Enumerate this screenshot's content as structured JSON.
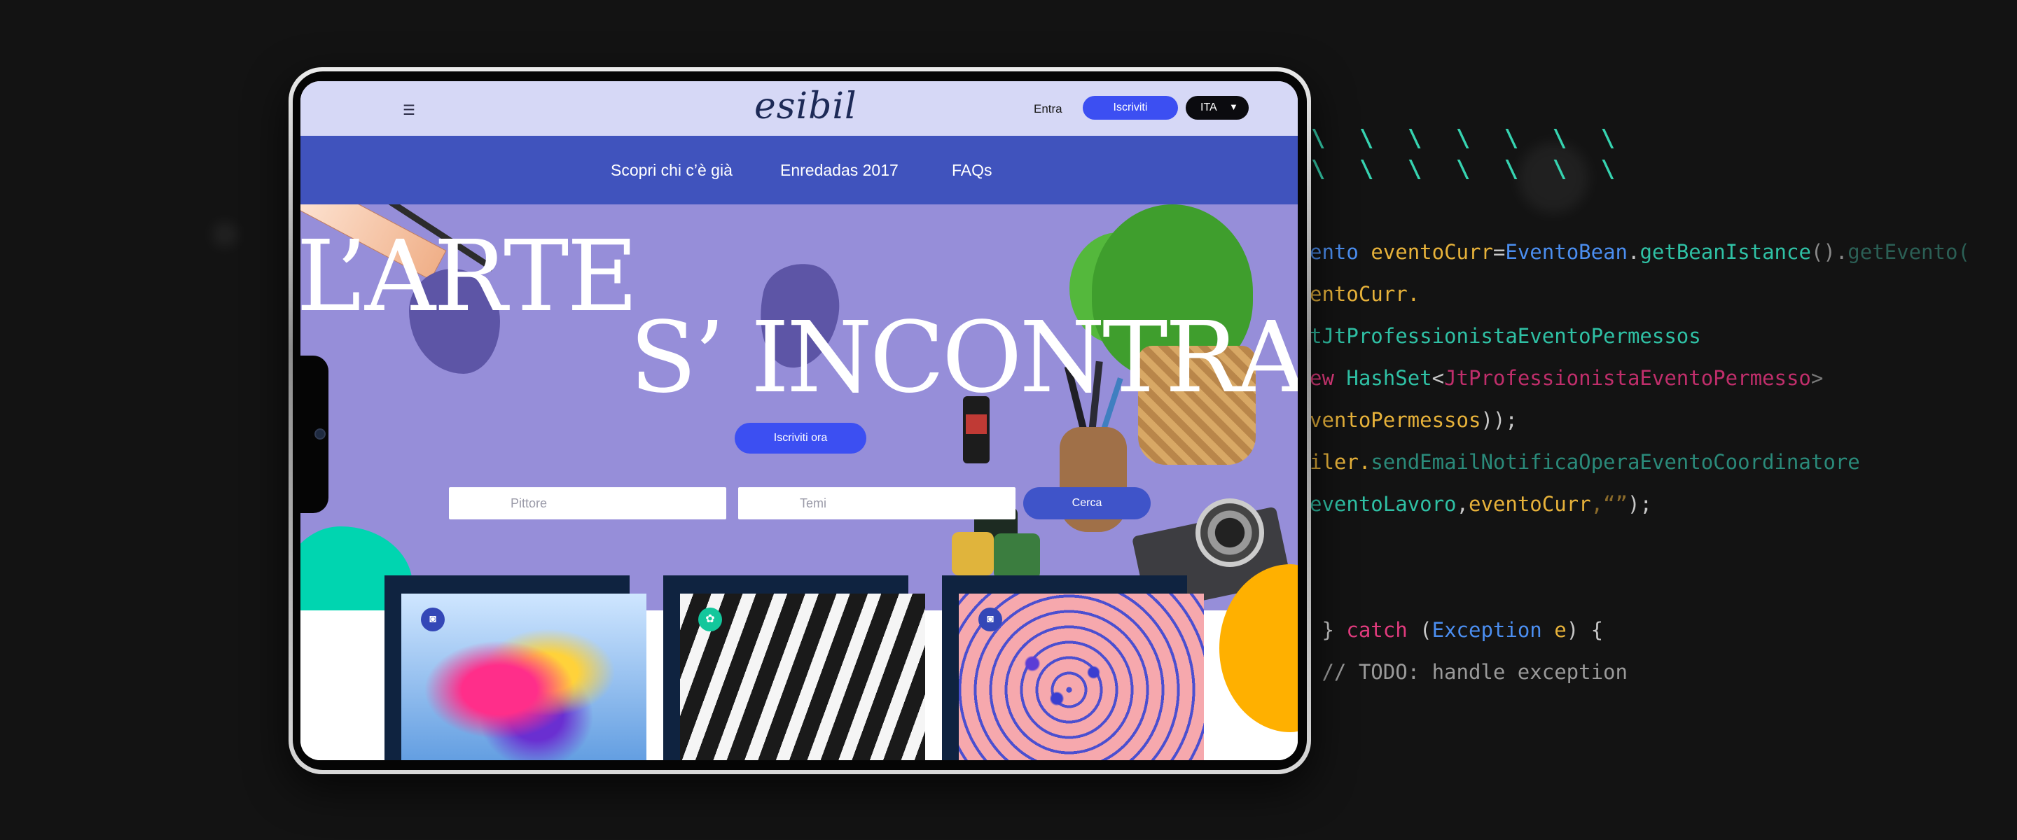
{
  "code_panel": {
    "slashes": [
      "\\ \\ \\ \\ \\ \\ \\",
      "\\ \\ \\ \\ \\ \\ \\"
    ],
    "lines": [
      [
        {
          "t": "ento ",
          "c": "#4b8ef0"
        },
        {
          "t": "eventoCurr",
          "c": "#e7b23a"
        },
        {
          "t": "=",
          "c": "#c7c7c7"
        },
        {
          "t": "EventoBean",
          "c": "#4b8ef0"
        },
        {
          "t": ".",
          "c": "#c7c7c7"
        },
        {
          "t": "getBeanIstance",
          "c": "#2fc1a5"
        },
        {
          "t": "().",
          "c": "#8a8a8a"
        },
        {
          "t": "getEvento(",
          "c": "#2b5f55"
        }
      ],
      [
        {
          "t": "entoCurr.",
          "c": "#e7b23a"
        }
      ],
      [
        {
          "t": "tJtProfessionistaEventoPermessos",
          "c": "#2fc1a5"
        }
      ],
      [
        {
          "t": "ew ",
          "c": "#e23b7e"
        },
        {
          "t": "HashSet",
          "c": "#2fc1a5"
        },
        {
          "t": "<",
          "c": "#c7c7c7"
        },
        {
          "t": "JtProfessionistaEventoPermesso",
          "c": "#c02e6b"
        },
        {
          "t": ">",
          "c": "#777777"
        }
      ],
      [
        {
          "t": "ventoPermessos",
          "c": "#e7b23a"
        },
        {
          "t": "));",
          "c": "#c7c7c7"
        }
      ],
      [
        {
          "t": "iler.",
          "c": "#e7b23a"
        },
        {
          "t": "sendEmailNotificaOperaEventoCoordinatore",
          "c": "#2a8a7a"
        }
      ],
      [
        {
          "t": "eventoLavoro",
          "c": "#2fc1a5"
        },
        {
          "t": ",",
          "c": "#c7c7c7"
        },
        {
          "t": "eventoCurr",
          "c": "#e7b23a"
        },
        {
          "t": ",“”",
          "c": "#8a6a2a"
        },
        {
          "t": ");",
          "c": "#c7c7c7"
        }
      ],
      [],
      [
        {
          "t": " } ",
          "c": "#c7c7c7"
        },
        {
          "t": "catch ",
          "c": "#e23b7e"
        },
        {
          "t": "(",
          "c": "#c7c7c7"
        },
        {
          "t": "Exception ",
          "c": "#4b8ef0"
        },
        {
          "t": "e",
          "c": "#e7b23a"
        },
        {
          "t": ") {",
          "c": "#c7c7c7"
        }
      ],
      [
        {
          "t": " // TODO: handle exception",
          "c": "#9a9a9a"
        }
      ]
    ]
  },
  "header": {
    "menu_icon": "☰",
    "logo": "esibil",
    "login": "Entra",
    "signup": "Iscriviti",
    "language": "ITA",
    "language_caret": "▼"
  },
  "nav": {
    "items": [
      "Scopri chi c’è già",
      "Enredadas 2017",
      "FAQs"
    ]
  },
  "hero": {
    "title_line1": "L’ARTE",
    "title_line2": "S’ INCONTRA",
    "cta": "Iscriviti ora",
    "search": {
      "field1_placeholder": "Pittore",
      "field2_placeholder": "Temi",
      "button": "Cerca"
    }
  },
  "cards": [
    {
      "icon": "camera-icon",
      "glyph": "◙"
    },
    {
      "icon": "palette-icon",
      "glyph": "✿"
    },
    {
      "icon": "camera-icon",
      "glyph": "◙"
    }
  ],
  "colors": {
    "background": "#131313",
    "topbar": "#d6d8f6",
    "nav": "#4053bd",
    "hero": "#968ed9",
    "accent": "#3c4ff2",
    "teal": "#00d5b0",
    "yellow": "#ffb000"
  }
}
